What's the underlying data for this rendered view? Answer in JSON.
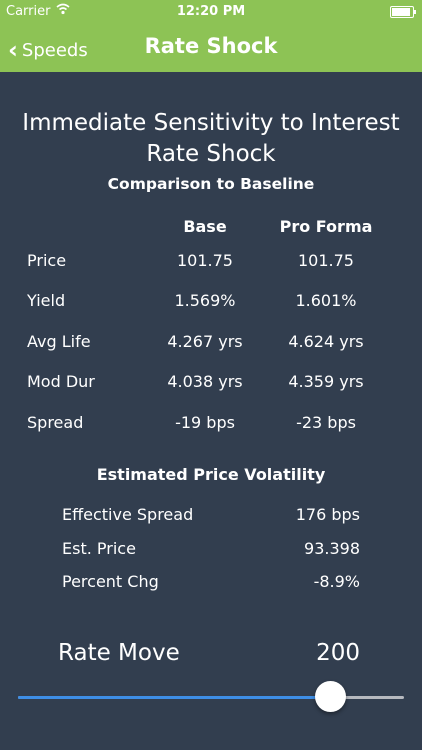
{
  "status_bar": {
    "carrier": "Carrier",
    "time": "12:20 PM",
    "battery_level": 0.95
  },
  "nav": {
    "back_label": "Speeds",
    "title": "Rate Shock"
  },
  "main": {
    "title_line1": "Immediate Sensitivity to Interest",
    "title_line2": "Rate Shock",
    "subtitle": "Comparison to Baseline"
  },
  "comparison": {
    "col_base": "Base",
    "col_proforma": "Pro Forma",
    "rows": [
      {
        "label": "Price",
        "base": "101.75",
        "proforma": "101.75"
      },
      {
        "label": "Yield",
        "base": "1.569%",
        "proforma": "1.601%"
      },
      {
        "label": "Avg Life",
        "base": "4.267 yrs",
        "proforma": "4.624 yrs"
      },
      {
        "label": "Mod Dur",
        "base": "4.038 yrs",
        "proforma": "4.359 yrs"
      },
      {
        "label": "Spread",
        "base": "-19 bps",
        "proforma": "-23 bps"
      }
    ]
  },
  "volatility": {
    "title": "Estimated Price Volatility",
    "rows": [
      {
        "label": "Effective Spread",
        "value": "176 bps"
      },
      {
        "label": "Est. Price",
        "value": "93.398"
      },
      {
        "label": "Percent Chg",
        "value": "-8.9%"
      }
    ]
  },
  "rate_move": {
    "label": "Rate Move",
    "value": "200",
    "slider_fraction": 0.81
  },
  "colors": {
    "nav_green": "#8dc355",
    "background": "#323e4f",
    "slider_blue": "#3e8ee6"
  },
  "icons": {
    "back": "chevron-left-icon",
    "wifi": "wifi-icon",
    "battery": "battery-icon"
  }
}
